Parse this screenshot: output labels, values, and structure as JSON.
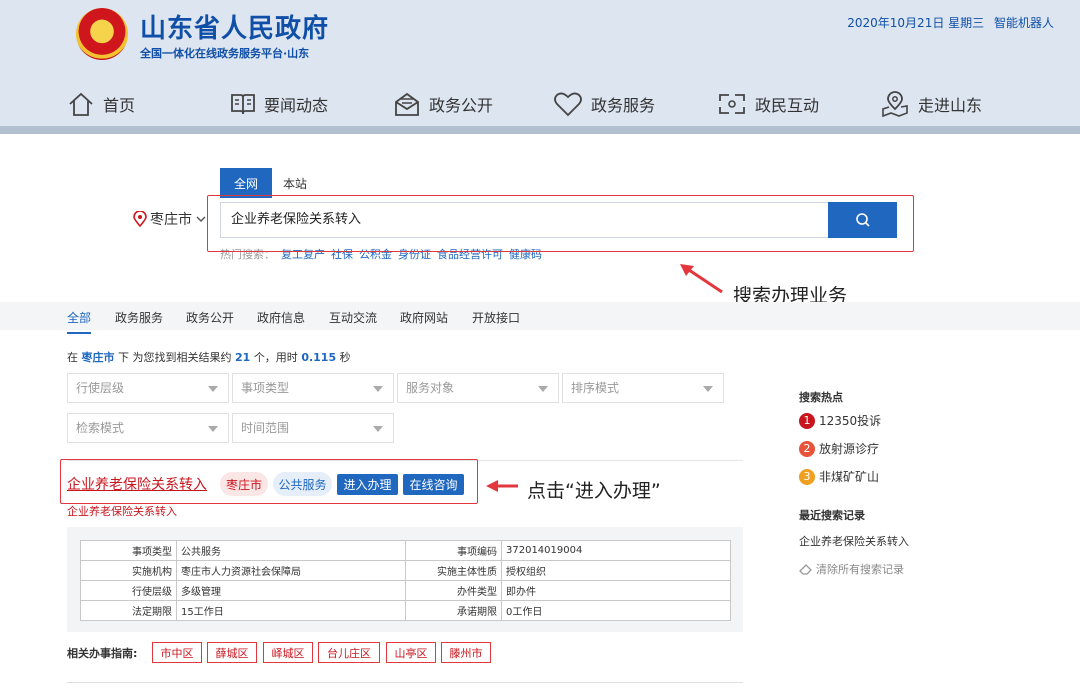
{
  "header": {
    "title": "山东省人民政府",
    "subtitle": "全国一体化在线政务服务平台·山东",
    "date": "2020年10月21日 星期三",
    "robot_link": "智能机器人"
  },
  "nav": [
    {
      "label": "首页",
      "icon": "home-icon"
    },
    {
      "label": "要闻动态",
      "icon": "book-icon"
    },
    {
      "label": "政务公开",
      "icon": "open-mail-icon"
    },
    {
      "label": "政务服务",
      "icon": "heart-icon"
    },
    {
      "label": "政民互动",
      "icon": "interact-icon"
    },
    {
      "label": "走进山东",
      "icon": "map-pin-icon"
    }
  ],
  "search": {
    "scope_tabs": [
      "全网",
      "本站"
    ],
    "city": "枣庄市",
    "query": "企业养老保险关系转入",
    "hot_label": "热门搜索：",
    "hot_terms": [
      "复工复产",
      "社保",
      "公积金",
      "身份证",
      "食品经营许可",
      "健康码"
    ]
  },
  "annotations": {
    "search_note": "搜索办理业务",
    "click_note": "点击“进入办理”"
  },
  "categories": [
    "全部",
    "政务服务",
    "政务公开",
    "政府信息",
    "互动交流",
    "政府网站",
    "开放接口"
  ],
  "result_info": {
    "prefix": "在",
    "city": "枣庄市",
    "mid": "下 为您找到相关结果约",
    "count": "21",
    "mid2": "个，用时",
    "time": "0.115",
    "suffix": "秒"
  },
  "filters": [
    "行使层级",
    "事项类型",
    "服务对象",
    "排序模式",
    "检索模式",
    "时间范围"
  ],
  "result": {
    "title": "企业养老保险关系转入",
    "tag_city": "枣庄市",
    "tag_type": "公共服务",
    "enter_button": "进入办理",
    "consult_button": "在线咨询",
    "subtitle": "企业养老保险关系转入",
    "details": [
      [
        "事项类型",
        "公共服务",
        "事项编码",
        "372014019004"
      ],
      [
        "实施机构",
        "枣庄市人力资源社会保障局",
        "实施主体性质",
        "授权组织"
      ],
      [
        "行使层级",
        "多级管理",
        "办件类型",
        "即办件"
      ],
      [
        "法定期限",
        "15工作日",
        "承诺期限",
        "0工作日"
      ]
    ]
  },
  "guides": {
    "label": "相关办事指南:",
    "items": [
      "市中区",
      "薛城区",
      "峄城区",
      "台儿庄区",
      "山亭区",
      "滕州市"
    ]
  },
  "side": {
    "hot_title": "搜索热点",
    "hot_items": [
      {
        "rank": "1",
        "text": "12350投诉",
        "color": "#c9151e"
      },
      {
        "rank": "2",
        "text": "放射源诊疗",
        "color": "#e8533a"
      },
      {
        "rank": "3",
        "text": "非煤矿矿山",
        "color": "#f0a020"
      }
    ],
    "recent_title": "最近搜索记录",
    "recent_items": [
      "企业养老保险关系转入"
    ],
    "clear_label": "清除所有搜索记录"
  }
}
